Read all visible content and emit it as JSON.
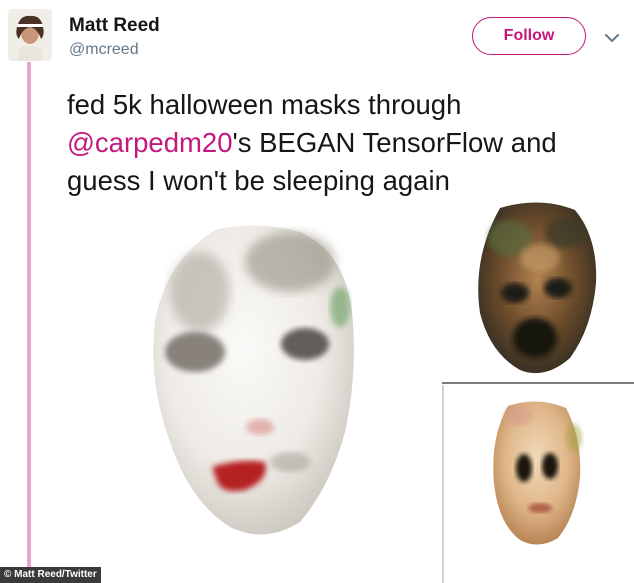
{
  "tweet": {
    "author_name": "Matt Reed",
    "author_handle": "@mcreed",
    "follow_label": "Follow",
    "text_part1": "fed 5k halloween masks through",
    "mention": "@carpedm20",
    "text_part2": "'s BEGAN TensorFlow and",
    "text_part3": "guess I won't be sleeping again"
  },
  "caption": {
    "credit": "© Matt Reed/Twitter"
  },
  "icons": {
    "more": "chevron-down-icon"
  },
  "colors": {
    "accent": "#c3187d",
    "thread": "#e8a6c9"
  }
}
